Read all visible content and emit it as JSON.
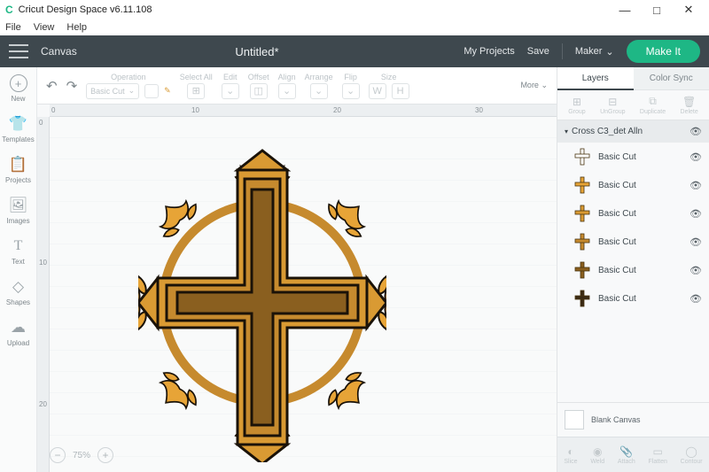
{
  "window": {
    "title": "Cricut Design Space v6.11.108",
    "controls": {
      "min": "—",
      "max": "□",
      "close": "✕"
    }
  },
  "menubar": [
    "File",
    "View",
    "Help"
  ],
  "appbar": {
    "canvas": "Canvas",
    "doc_title": "Untitled*",
    "my_projects": "My Projects",
    "save": "Save",
    "machine": "Maker",
    "make_it": "Make It"
  },
  "left_tools": [
    {
      "id": "new",
      "label": "New"
    },
    {
      "id": "templates",
      "label": "Templates"
    },
    {
      "id": "projects",
      "label": "Projects"
    },
    {
      "id": "images",
      "label": "Images"
    },
    {
      "id": "text",
      "label": "Text"
    },
    {
      "id": "shapes",
      "label": "Shapes"
    },
    {
      "id": "upload",
      "label": "Upload"
    }
  ],
  "toolbar": {
    "operation_label": "Operation",
    "operation_value": "Basic Cut",
    "select_all": "Select All",
    "edit": "Edit",
    "offset": "Offset",
    "align": "Align",
    "arrange": "Arrange",
    "flip": "Flip",
    "size": "Size",
    "more": "More"
  },
  "ruler": {
    "h": [
      "0",
      "10",
      "20",
      "30"
    ],
    "v": [
      "0",
      "10",
      "20"
    ]
  },
  "zoom": {
    "value": "75%"
  },
  "layers_panel": {
    "tabs": {
      "layers": "Layers",
      "colorsync": "Color Sync"
    },
    "ops_top": [
      "Group",
      "UnGroup",
      "Duplicate",
      "Delete"
    ],
    "group_name": "Cross C3_det Alln",
    "layers": [
      {
        "label": "Basic Cut",
        "color": "#ffffff"
      },
      {
        "label": "Basic Cut",
        "color": "#e7a437"
      },
      {
        "label": "Basic Cut",
        "color": "#d99a33"
      },
      {
        "label": "Basic Cut",
        "color": "#c68a2e"
      },
      {
        "label": "Basic Cut",
        "color": "#8a5f1f"
      },
      {
        "label": "Basic Cut",
        "color": "#3a2a14"
      }
    ],
    "blank": "Blank Canvas",
    "ops_bottom": [
      "Slice",
      "Weld",
      "Attach",
      "Flatten",
      "Contour"
    ]
  }
}
